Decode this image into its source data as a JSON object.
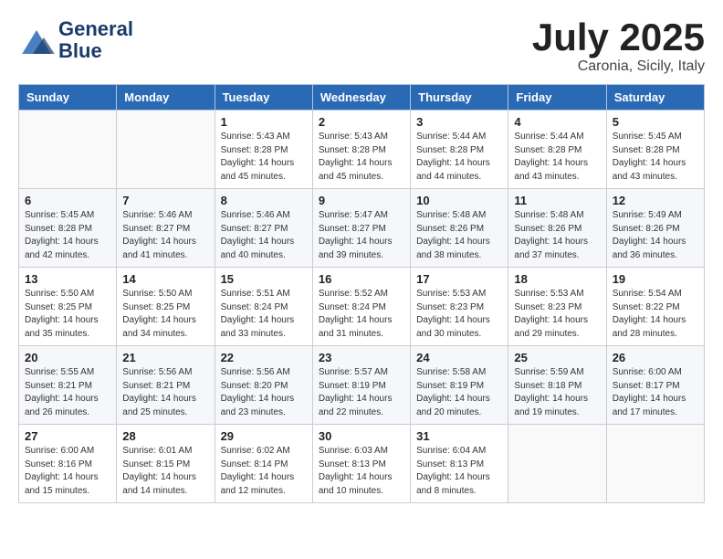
{
  "logo": {
    "line1": "General",
    "line2": "Blue"
  },
  "title": "July 2025",
  "location": "Caronia, Sicily, Italy",
  "days_of_week": [
    "Sunday",
    "Monday",
    "Tuesday",
    "Wednesday",
    "Thursday",
    "Friday",
    "Saturday"
  ],
  "weeks": [
    [
      {
        "day": "",
        "info": ""
      },
      {
        "day": "",
        "info": ""
      },
      {
        "day": "1",
        "info": "Sunrise: 5:43 AM\nSunset: 8:28 PM\nDaylight: 14 hours and 45 minutes."
      },
      {
        "day": "2",
        "info": "Sunrise: 5:43 AM\nSunset: 8:28 PM\nDaylight: 14 hours and 45 minutes."
      },
      {
        "day": "3",
        "info": "Sunrise: 5:44 AM\nSunset: 8:28 PM\nDaylight: 14 hours and 44 minutes."
      },
      {
        "day": "4",
        "info": "Sunrise: 5:44 AM\nSunset: 8:28 PM\nDaylight: 14 hours and 43 minutes."
      },
      {
        "day": "5",
        "info": "Sunrise: 5:45 AM\nSunset: 8:28 PM\nDaylight: 14 hours and 43 minutes."
      }
    ],
    [
      {
        "day": "6",
        "info": "Sunrise: 5:45 AM\nSunset: 8:28 PM\nDaylight: 14 hours and 42 minutes."
      },
      {
        "day": "7",
        "info": "Sunrise: 5:46 AM\nSunset: 8:27 PM\nDaylight: 14 hours and 41 minutes."
      },
      {
        "day": "8",
        "info": "Sunrise: 5:46 AM\nSunset: 8:27 PM\nDaylight: 14 hours and 40 minutes."
      },
      {
        "day": "9",
        "info": "Sunrise: 5:47 AM\nSunset: 8:27 PM\nDaylight: 14 hours and 39 minutes."
      },
      {
        "day": "10",
        "info": "Sunrise: 5:48 AM\nSunset: 8:26 PM\nDaylight: 14 hours and 38 minutes."
      },
      {
        "day": "11",
        "info": "Sunrise: 5:48 AM\nSunset: 8:26 PM\nDaylight: 14 hours and 37 minutes."
      },
      {
        "day": "12",
        "info": "Sunrise: 5:49 AM\nSunset: 8:26 PM\nDaylight: 14 hours and 36 minutes."
      }
    ],
    [
      {
        "day": "13",
        "info": "Sunrise: 5:50 AM\nSunset: 8:25 PM\nDaylight: 14 hours and 35 minutes."
      },
      {
        "day": "14",
        "info": "Sunrise: 5:50 AM\nSunset: 8:25 PM\nDaylight: 14 hours and 34 minutes."
      },
      {
        "day": "15",
        "info": "Sunrise: 5:51 AM\nSunset: 8:24 PM\nDaylight: 14 hours and 33 minutes."
      },
      {
        "day": "16",
        "info": "Sunrise: 5:52 AM\nSunset: 8:24 PM\nDaylight: 14 hours and 31 minutes."
      },
      {
        "day": "17",
        "info": "Sunrise: 5:53 AM\nSunset: 8:23 PM\nDaylight: 14 hours and 30 minutes."
      },
      {
        "day": "18",
        "info": "Sunrise: 5:53 AM\nSunset: 8:23 PM\nDaylight: 14 hours and 29 minutes."
      },
      {
        "day": "19",
        "info": "Sunrise: 5:54 AM\nSunset: 8:22 PM\nDaylight: 14 hours and 28 minutes."
      }
    ],
    [
      {
        "day": "20",
        "info": "Sunrise: 5:55 AM\nSunset: 8:21 PM\nDaylight: 14 hours and 26 minutes."
      },
      {
        "day": "21",
        "info": "Sunrise: 5:56 AM\nSunset: 8:21 PM\nDaylight: 14 hours and 25 minutes."
      },
      {
        "day": "22",
        "info": "Sunrise: 5:56 AM\nSunset: 8:20 PM\nDaylight: 14 hours and 23 minutes."
      },
      {
        "day": "23",
        "info": "Sunrise: 5:57 AM\nSunset: 8:19 PM\nDaylight: 14 hours and 22 minutes."
      },
      {
        "day": "24",
        "info": "Sunrise: 5:58 AM\nSunset: 8:19 PM\nDaylight: 14 hours and 20 minutes."
      },
      {
        "day": "25",
        "info": "Sunrise: 5:59 AM\nSunset: 8:18 PM\nDaylight: 14 hours and 19 minutes."
      },
      {
        "day": "26",
        "info": "Sunrise: 6:00 AM\nSunset: 8:17 PM\nDaylight: 14 hours and 17 minutes."
      }
    ],
    [
      {
        "day": "27",
        "info": "Sunrise: 6:00 AM\nSunset: 8:16 PM\nDaylight: 14 hours and 15 minutes."
      },
      {
        "day": "28",
        "info": "Sunrise: 6:01 AM\nSunset: 8:15 PM\nDaylight: 14 hours and 14 minutes."
      },
      {
        "day": "29",
        "info": "Sunrise: 6:02 AM\nSunset: 8:14 PM\nDaylight: 14 hours and 12 minutes."
      },
      {
        "day": "30",
        "info": "Sunrise: 6:03 AM\nSunset: 8:13 PM\nDaylight: 14 hours and 10 minutes."
      },
      {
        "day": "31",
        "info": "Sunrise: 6:04 AM\nSunset: 8:13 PM\nDaylight: 14 hours and 8 minutes."
      },
      {
        "day": "",
        "info": ""
      },
      {
        "day": "",
        "info": ""
      }
    ]
  ]
}
